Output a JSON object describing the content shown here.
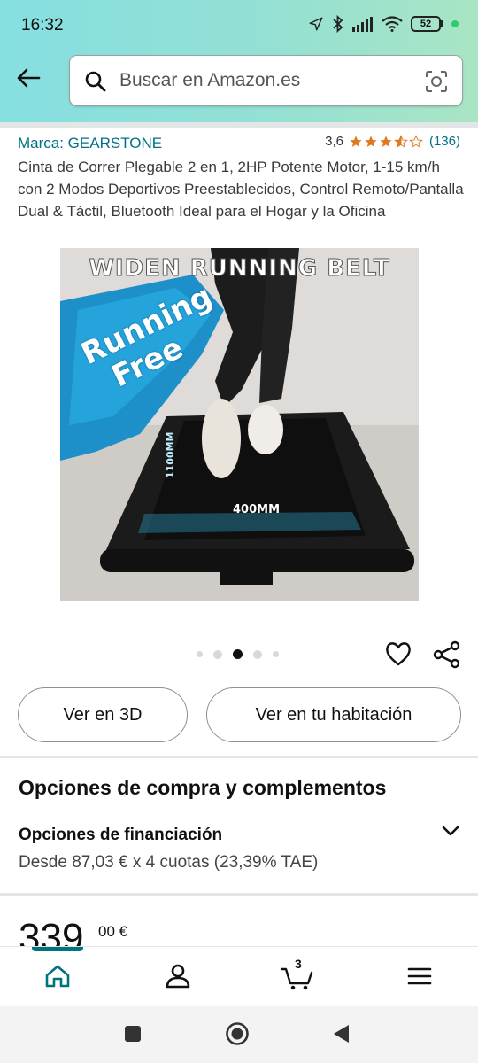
{
  "status_bar": {
    "time": "16:32",
    "battery": "52",
    "icons": [
      "location-arrow-icon",
      "bluetooth-icon",
      "signal-icon",
      "wifi-icon",
      "battery-icon"
    ]
  },
  "header": {
    "back_icon": "arrow-left-icon",
    "search_placeholder": "Buscar en Amazon.es",
    "camera_icon": "camera-scan-icon"
  },
  "product": {
    "brand": "Marca: GEARSTONE",
    "rating_value": "3,6",
    "rating": 3.6,
    "rating_count": "(136)",
    "title": "Cinta de Correr Plegable 2 en 1, 2HP Potente Motor, 1-15 km/h con 2 Modos Deportivos Preestablecidos, Control Remoto/Pantalla Dual & Táctil, Bluetooth Ideal para el Hogar y la Oficina",
    "image": {
      "headline": "WIDEN RUNNING BELT",
      "slogan_line1": "Running",
      "slogan_line2": "Free",
      "width_label": "400MM",
      "length_label": "1100MM"
    },
    "carousel": {
      "count": 5,
      "active_index": 2
    }
  },
  "actions": {
    "view_3d": "Ver en 3D",
    "view_room": "Ver en tu habitación"
  },
  "purchase_options": {
    "title": "Opciones de compra y complementos",
    "financing_title": "Opciones de financiación",
    "financing_text": "Desde 87,03 € x 4 cuotas (23,39% TAE)"
  },
  "price": {
    "whole": "339",
    "fraction": "00 €"
  },
  "bottom_nav": {
    "items": [
      "home-icon",
      "account-icon",
      "cart-icon",
      "menu-icon"
    ],
    "cart_count": "3"
  },
  "colors": {
    "accent_teal": "#007185",
    "nav_indicator": "#00737f",
    "star": "#de7921",
    "header_gradient_start": "#86dfe1",
    "header_gradient_end": "#a9e5c4"
  }
}
